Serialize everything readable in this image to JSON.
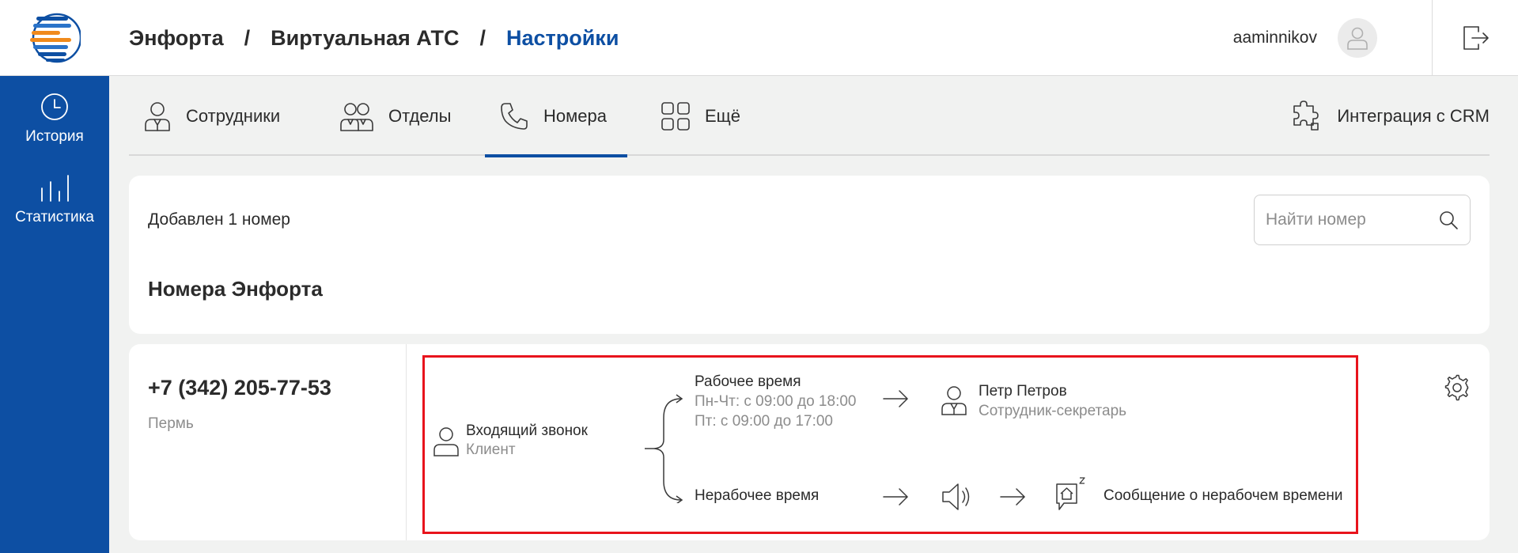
{
  "breadcrumb": {
    "items": [
      "Энфорта",
      "Виртуальная АТС"
    ],
    "separator": "/",
    "current": "Настройки"
  },
  "user": {
    "name": "aaminnikov"
  },
  "sidebar": {
    "items": [
      {
        "label": "История",
        "icon": "clock-icon"
      },
      {
        "label": "Статистика",
        "icon": "bar-chart-icon"
      }
    ]
  },
  "tabs": {
    "items": [
      {
        "label": "Сотрудники",
        "icon": "employee-icon"
      },
      {
        "label": "Отделы",
        "icon": "departments-icon"
      },
      {
        "label": "Номера",
        "icon": "phone-icon",
        "active": true
      },
      {
        "label": "Ещё",
        "icon": "grid-icon"
      }
    ],
    "integration": {
      "label": "Интеграция с CRM",
      "icon": "puzzle-icon"
    }
  },
  "numbers_panel": {
    "count_text": "Добавлен 1 номер",
    "search_placeholder": "Найти номер",
    "section_title": "Номера Энфорта"
  },
  "number_card": {
    "phone": "+7 (342) 205-77-53",
    "city": "Пермь",
    "flow": {
      "incoming": {
        "title": "Входящий звонок",
        "subtitle": "Клиент"
      },
      "work_time": {
        "title": "Рабочее время",
        "schedule_1": "Пн-Чт: с 09:00 до 18:00",
        "schedule_2": "Пт: с 09:00 до 17:00"
      },
      "employee": {
        "name": "Петр Петров",
        "role": "Сотрудник-секретарь"
      },
      "non_work_time": {
        "title": "Нерабочее время"
      },
      "message": {
        "title": "Сообщение о нерабочем времени"
      }
    }
  },
  "colors": {
    "brand": "#0d4fa3",
    "highlight": "#e8141c",
    "muted_text": "#8c8c8c"
  }
}
